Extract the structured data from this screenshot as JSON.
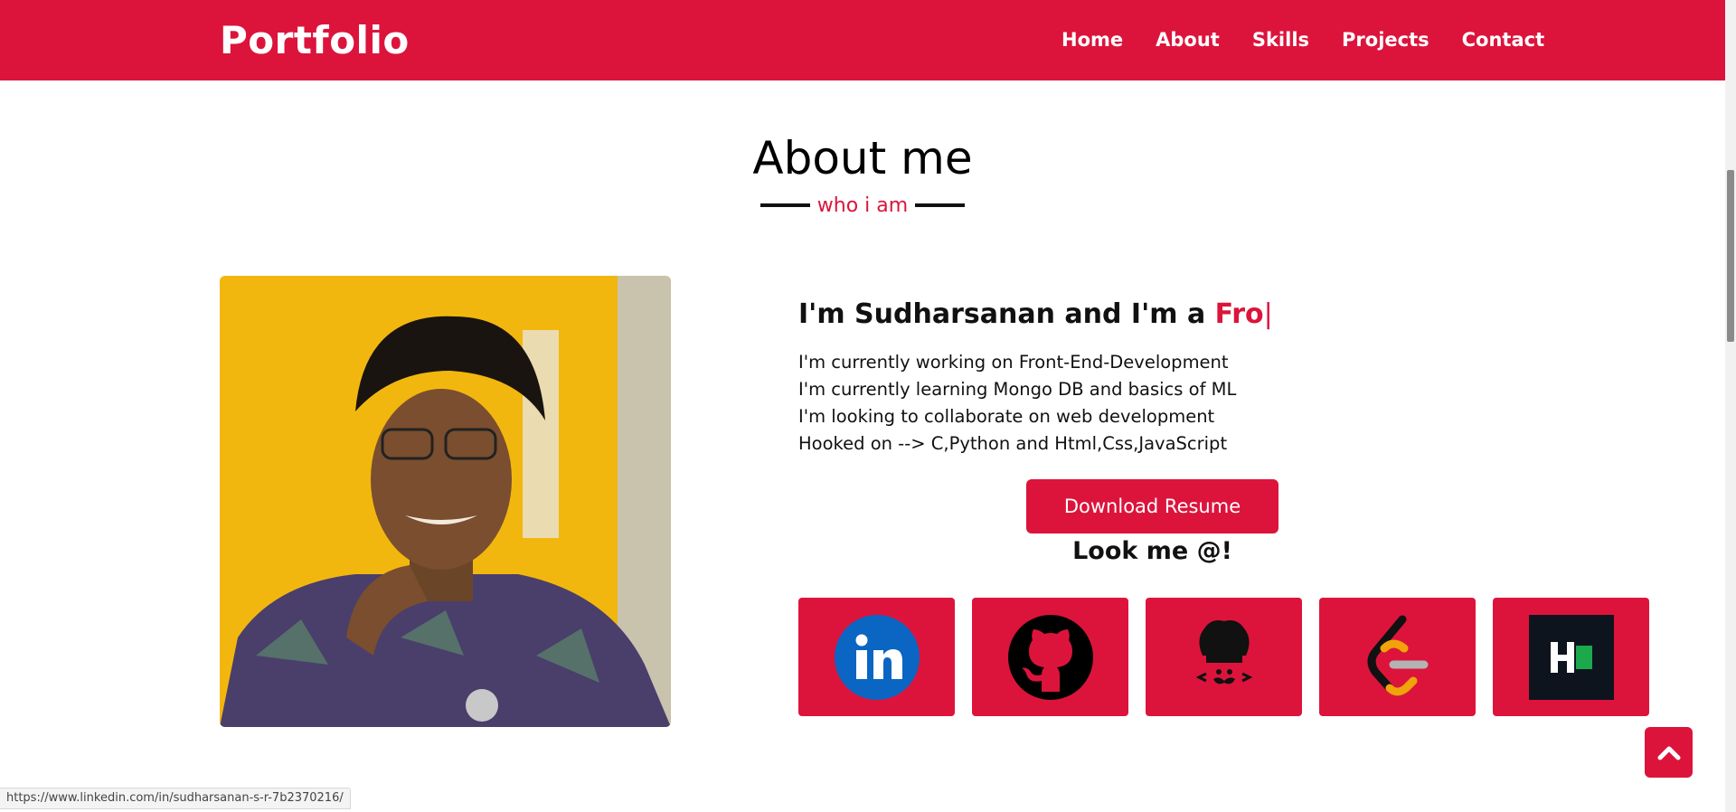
{
  "navbar": {
    "brand": "Portfolio",
    "links": [
      "Home",
      "About",
      "Skills",
      "Projects",
      "Contact"
    ],
    "background": "#dc143c"
  },
  "about": {
    "title": "About me",
    "subtitle": "who i am",
    "intro_static": "I'm Sudharsanan and I'm a ",
    "intro_typed": "Fro",
    "intro_cursor": "|",
    "lines": [
      "I'm currently working on Front-End-Development",
      "I'm currently learning Mongo DB and basics of ML",
      "I'm looking to collaborate on web development",
      "Hooked on --> C,Python and Html,Css,JavaScript"
    ],
    "download_label": "Download Resume",
    "look_me": "Look me @!",
    "socials": [
      {
        "icon": "linkedin-icon"
      },
      {
        "icon": "github-icon"
      },
      {
        "icon": "codechef-icon"
      },
      {
        "icon": "leetcode-icon"
      },
      {
        "icon": "hackerrank-icon"
      }
    ]
  },
  "scroll_top": {
    "icon": "chevron-up-icon"
  },
  "status_bar": {
    "url": "https://www.linkedin.com/in/sudharsanan-s-r-7b2370216/"
  },
  "colors": {
    "accent": "#dc143c",
    "text": "#111111",
    "background": "#ffffff"
  }
}
